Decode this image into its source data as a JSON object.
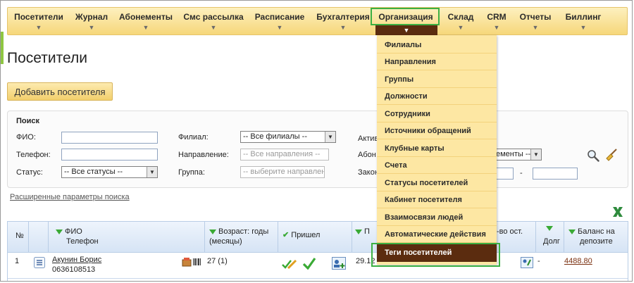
{
  "nav": {
    "items": [
      "Посетители",
      "Журнал",
      "Абонементы",
      "Смс рассылка",
      "Расписание",
      "Бухгалтерия",
      "Организация",
      "Склад",
      "CRM",
      "Отчеты",
      "Биллинг"
    ],
    "arrow": "▼"
  },
  "page": {
    "title": "Посетители",
    "add_button": "Добавить посетителя"
  },
  "search": {
    "title": "Поиск",
    "fio_label": "ФИО:",
    "phone_label": "Телефон:",
    "status_label": "Статус:",
    "status_value": "-- Все статусы --",
    "branch_label": "Филиал:",
    "branch_value": "-- Все филиалы --",
    "direction_label": "Направление:",
    "direction_value": "-- Все направления --",
    "group_label": "Группа:",
    "group_value": "-- выберите направление",
    "active_label": "Актив",
    "abon_label": "Абон",
    "contract_label": "Закон",
    "subscription_value": "ементы --",
    "dash": "-"
  },
  "advanced_link": "Расширенные параметры поиска",
  "table": {
    "headers": {
      "num": "№",
      "fio": "ФИО",
      "phone": "Телефон",
      "age": "Возраст: годы",
      "age2": "(месяцы)",
      "came": "Пришел",
      "p": "П",
      "remaining": "-во ост.",
      "debt": "Долг",
      "balance": "Баланс на",
      "balance2": "депозите"
    },
    "row": {
      "num": "1",
      "name": "Акунин Борис",
      "phone": "0636108513",
      "age": "27 (1)",
      "date": "29.12",
      "debt": "-",
      "balance": "4488.80"
    }
  },
  "menu": {
    "items": [
      "Филиалы",
      "Направления",
      "Группы",
      "Должности",
      "Сотрудники",
      "Источники обращений",
      "Клубные карты",
      "Счета",
      "Статусы посетителей",
      "Кабинет посетителя",
      "Взаимосвязи людей",
      "Автоматические действия",
      "Теги посетителей"
    ]
  },
  "colors": {
    "nav_bg": "#f6d77a",
    "menu_bg": "#fde7a3",
    "highlight": "#5b2c0f",
    "outline": "#3cb043"
  }
}
